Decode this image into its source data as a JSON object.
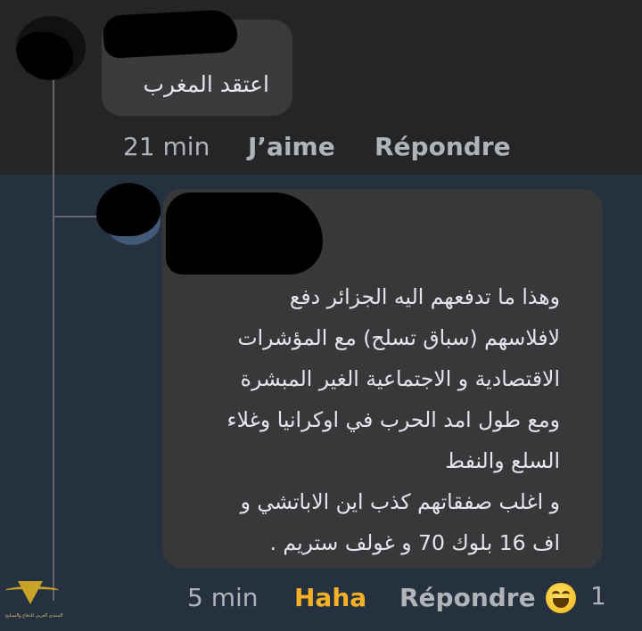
{
  "comments": [
    {
      "text": "اعتقد المغرب",
      "time": "21 min",
      "like_label": "J’aime",
      "reply_label": "Répondre"
    },
    {
      "text": "وهذا ما تدفعهم اليه الجزائر دفع\nلافلاسهم (سباق تسلح) مع المؤشرات\nالاقتصادية و الاجتماعية الغير المبشرة\nومع طول امد الحرب في اوكرانيا وغلاء\nالسلع والنفط\nو اغلب صفقاتهم كذب اين الاباتشي و\nاف 16 بلوك 70 و غولف ستريم .",
      "time": "5 min",
      "reaction_label": "Haha",
      "reply_label": "Répondre",
      "reaction_icon": "laughing-emoji-icon",
      "reaction_count": "1"
    }
  ],
  "watermark_text": "المنتدى العربي للدفاع والتسليح",
  "colors": {
    "background_top": "#242526",
    "background_highlight": "#263140",
    "bubble": "#3a3b3c",
    "text": "#e4e6eb",
    "meta": "#b0b3b8",
    "haha": "#f7b125"
  }
}
